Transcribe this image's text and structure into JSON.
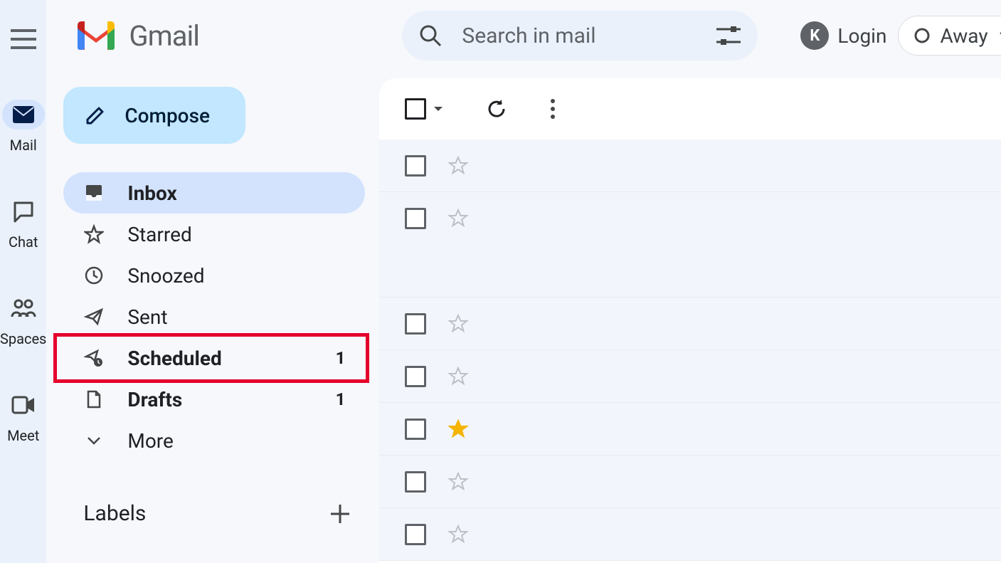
{
  "app": {
    "name": "Gmail"
  },
  "rail": {
    "items": [
      {
        "label": "Mail",
        "active": true
      },
      {
        "label": "Chat",
        "active": false
      },
      {
        "label": "Spaces",
        "active": false
      },
      {
        "label": "Meet",
        "active": false
      }
    ]
  },
  "header": {
    "search_placeholder": "Search in mail",
    "login_label": "Login",
    "status_label": "Away",
    "avatar_letter": "K"
  },
  "compose": {
    "label": "Compose"
  },
  "nav": {
    "items": [
      {
        "label": "Inbox",
        "count": "",
        "bold": true,
        "selected": true,
        "highlighted": false,
        "icon": "inbox"
      },
      {
        "label": "Starred",
        "count": "",
        "bold": false,
        "selected": false,
        "highlighted": false,
        "icon": "star"
      },
      {
        "label": "Snoozed",
        "count": "",
        "bold": false,
        "selected": false,
        "highlighted": false,
        "icon": "clock"
      },
      {
        "label": "Sent",
        "count": "",
        "bold": false,
        "selected": false,
        "highlighted": false,
        "icon": "send"
      },
      {
        "label": "Scheduled",
        "count": "1",
        "bold": true,
        "selected": false,
        "highlighted": true,
        "icon": "schedule"
      },
      {
        "label": "Drafts",
        "count": "1",
        "bold": true,
        "selected": false,
        "highlighted": false,
        "icon": "draft"
      },
      {
        "label": "More",
        "count": "",
        "bold": false,
        "selected": false,
        "highlighted": false,
        "icon": "expand"
      }
    ]
  },
  "labels": {
    "heading": "Labels"
  },
  "mail_list": {
    "rows": [
      {
        "starred": false,
        "tall": false
      },
      {
        "starred": false,
        "tall": true
      },
      {
        "starred": false,
        "tall": false
      },
      {
        "starred": false,
        "tall": false
      },
      {
        "starred": true,
        "tall": false
      },
      {
        "starred": false,
        "tall": false
      },
      {
        "starred": false,
        "tall": false
      }
    ]
  }
}
